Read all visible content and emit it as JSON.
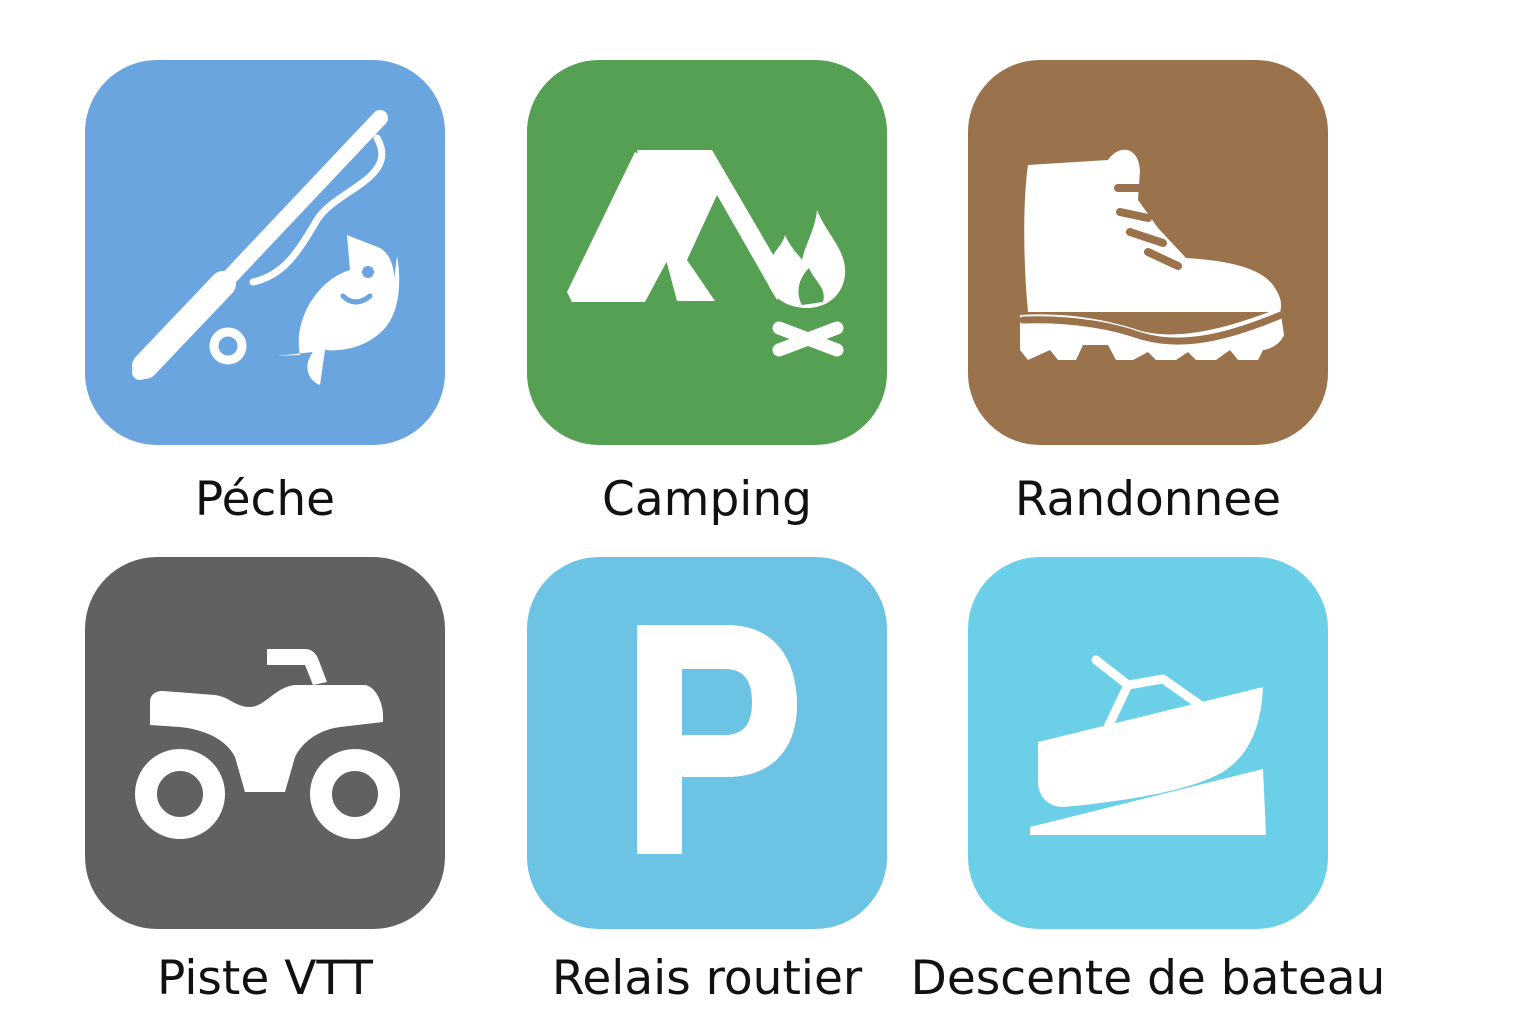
{
  "tiles": [
    {
      "id": "peche",
      "label": "Péche",
      "icon": "fishing-icon",
      "color": "#6aa5e0"
    },
    {
      "id": "camping",
      "label": "Camping",
      "icon": "tent-campfire-icon",
      "color": "#55a052"
    },
    {
      "id": "randonnee",
      "label": "Randonnee",
      "icon": "hiking-boot-icon",
      "color": "#9a734d"
    },
    {
      "id": "piste_vtt",
      "label": "Piste VTT",
      "icon": "atv-icon",
      "color": "#616161"
    },
    {
      "id": "relais_routier",
      "label": "Relais routier",
      "icon": "parking-icon",
      "color": "#6cc3e3"
    },
    {
      "id": "descente_bateau",
      "label": "Descente de bateau",
      "icon": "boat-launch-icon",
      "color": "#6ccfe8"
    }
  ]
}
